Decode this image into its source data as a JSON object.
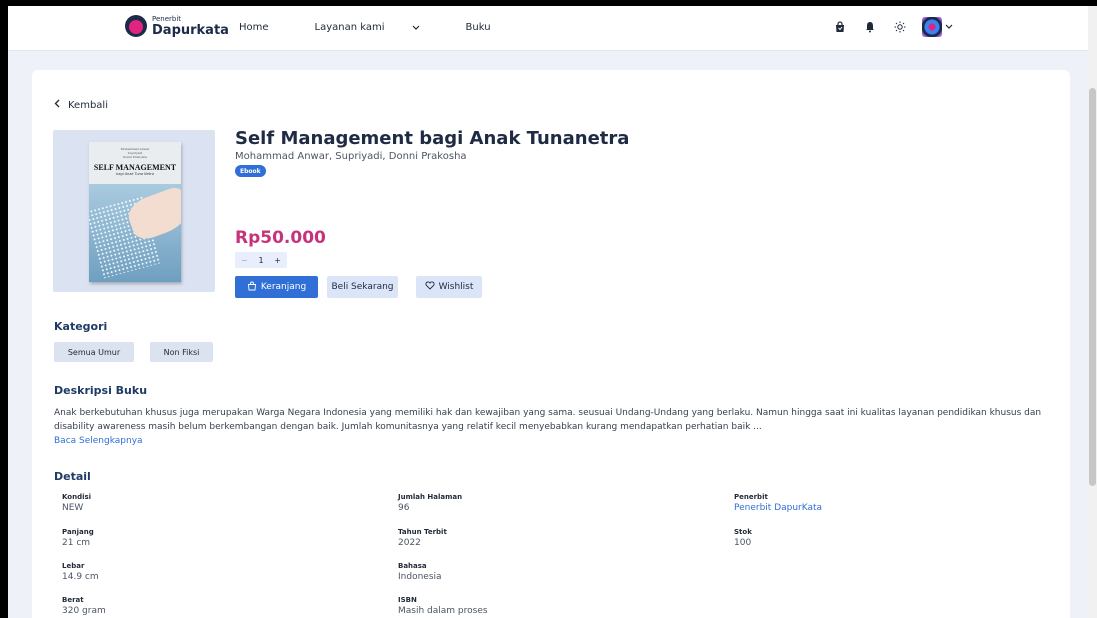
{
  "header": {
    "logo_small": "Penerbit",
    "logo_big": "Dapurkata",
    "nav": [
      {
        "label": "Home"
      },
      {
        "label": "Layanan kami"
      },
      {
        "label": "Buku"
      }
    ],
    "icons": [
      "shopping-bag-icon",
      "bell-icon",
      "sun-icon"
    ]
  },
  "page": {
    "back_label": "Kembali",
    "book": {
      "title": "Self Management bagi Anak Tunanetra",
      "authors": "Mohammad Anwar, Supriyadi, Donni Prakosha",
      "badge": "Ebook",
      "price": "Rp50.000",
      "quantity": "1",
      "qty_minus": "−",
      "qty_plus": "+",
      "cover": {
        "authors": "Mohammad Anwar\nSupriyadi\nDonni Prakosha",
        "title": "SELF MANAGEMENT",
        "subtitle": "bagi Anak Tuna Netra"
      }
    },
    "buttons": {
      "cart": "Keranjang",
      "buy": "Beli Sekarang",
      "wishlist": "Wishlist"
    },
    "kategori": {
      "title": "Kategori",
      "chips": [
        "Semua Umur",
        "Non Fiksi"
      ]
    },
    "deskripsi": {
      "title": "Deskripsi Buku",
      "text": "Anak berkebutuhan khusus juga merupakan Warga Negara Indonesia yang memiliki hak dan kewajiban yang sama. seusuai Undang-Undang yang berlaku. Namun hingga saat ini kualitas layanan pendidikan khusus dan disability awareness masih belum berkembangan dengan baik. Jumlah komunitasnya yang relatif kecil menyebabkan kurang mendapatkan perhatian baik ...",
      "read_more": "Baca Selengkapnya"
    },
    "detail": {
      "title": "Detail",
      "items": [
        {
          "label": "Kondisi",
          "value": "NEW"
        },
        {
          "label": "Panjang",
          "value": "21 cm"
        },
        {
          "label": "Lebar",
          "value": "14.9 cm"
        },
        {
          "label": "Berat",
          "value": "320 gram"
        },
        {
          "label": "Jumlah Halaman",
          "value": "96"
        },
        {
          "label": "Tahun Terbit",
          "value": "2022"
        },
        {
          "label": "Bahasa",
          "value": "Indonesia"
        },
        {
          "label": "ISBN",
          "value": "Masih dalam proses"
        },
        {
          "label": "Penerbit",
          "value": "Penerbit DapurKata"
        },
        {
          "label": "Stok",
          "value": "100"
        }
      ]
    }
  },
  "colors": {
    "primary": "#2f6fd6",
    "price": "#c7337a",
    "heading": "#1f3a66",
    "background": "#eef1f7"
  }
}
